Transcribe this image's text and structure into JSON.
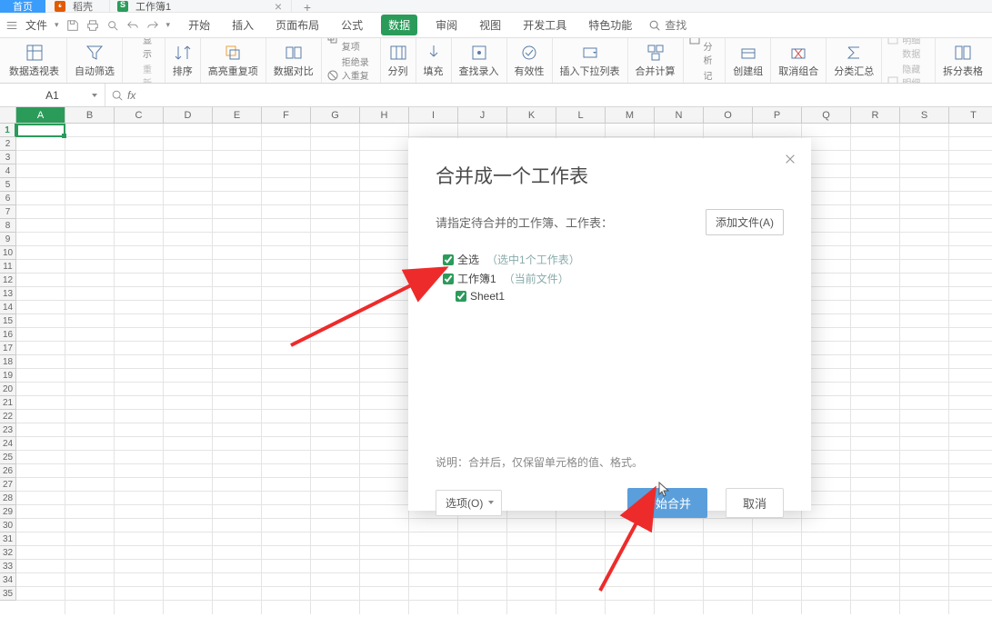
{
  "tabs": {
    "home": "首页",
    "doke": "稻壳",
    "current": "工作簿1",
    "close": "×",
    "add": "+"
  },
  "quick": {
    "file_menu": "文件"
  },
  "menu": {
    "start": "开始",
    "insert": "插入",
    "page_layout": "页面布局",
    "formulas": "公式",
    "data": "数据",
    "review": "审阅",
    "view": "视图",
    "developer": "开发工具",
    "special": "特色功能",
    "search": "查找"
  },
  "ribbon": {
    "pivot": "数据透视表",
    "auto_filter": "自动筛选",
    "show_all": "全部显示",
    "reapply": "重新应用",
    "sort": "排序",
    "highlight_dup": "高亮重复项",
    "data_compare": "数据对比",
    "remove_dup": "删除重复项",
    "reject_dup": "拒绝录入重复项",
    "text_to_col": "分列",
    "fill": "填充",
    "findrecord": "查找录入",
    "validation": "有效性",
    "dropdown": "插入下拉列表",
    "consolidate": "合并计算",
    "whatif": "模拟分析",
    "record_form": "记录单",
    "group": "创建组",
    "ungroup": "取消组合",
    "subtotal": "分类汇总",
    "show_detail": "显示明细数据",
    "hide_detail": "隐藏明细数据",
    "split_table": "拆分表格"
  },
  "refbar": {
    "active_cell": "A1",
    "fx": "fx"
  },
  "grid": {
    "cols": [
      "A",
      "B",
      "C",
      "D",
      "E",
      "F",
      "G",
      "H",
      "I",
      "J",
      "K",
      "L",
      "M",
      "N",
      "O",
      "P",
      "Q",
      "R",
      "S",
      "T"
    ],
    "row_count": 35
  },
  "dialog": {
    "title": "合并成一个工作表",
    "prompt": "请指定待合并的工作簿、工作表：",
    "add_file": "添加文件(A)",
    "select_all": "全选",
    "select_note": "（选中1个工作表）",
    "workbook_name": "工作簿1",
    "current_file_note": "（当前文件）",
    "sheet_name": "Sheet1",
    "note": "说明：合并后，仅保留单元格的值、格式。",
    "options": "选项(O)",
    "start_merge": "开始合并",
    "cancel": "取消"
  }
}
